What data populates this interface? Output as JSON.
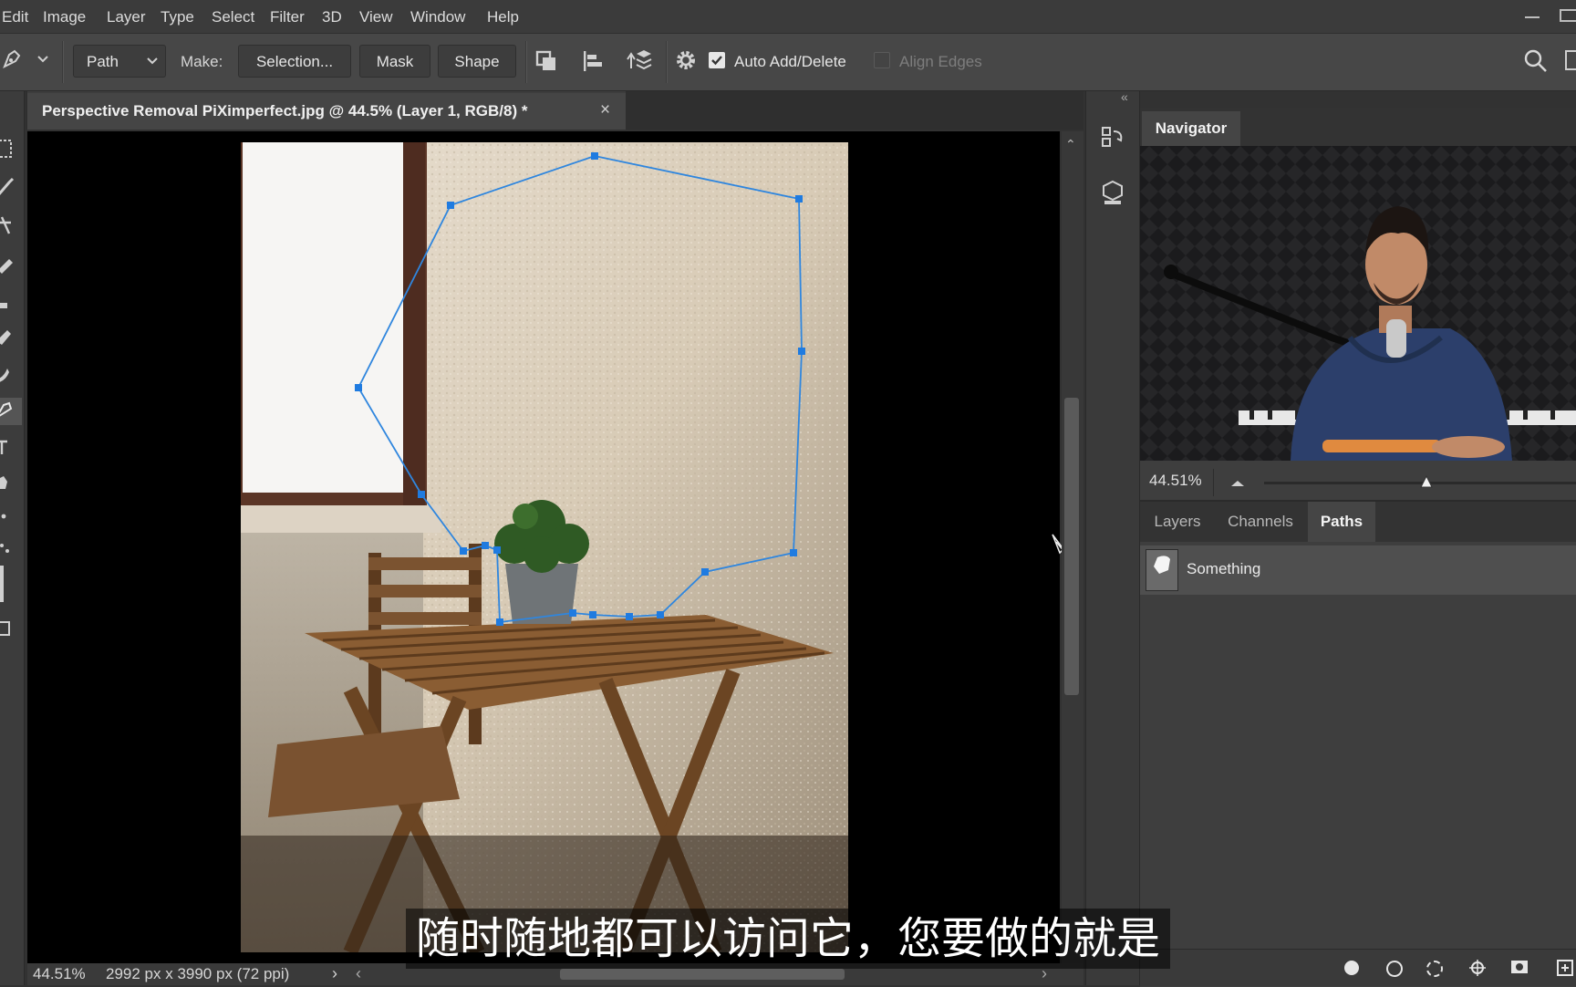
{
  "menu": {
    "items": [
      "Edit",
      "Image",
      "Layer",
      "Type",
      "Select",
      "Filter",
      "3D",
      "View",
      "Window",
      "Help"
    ]
  },
  "options": {
    "mode_value": "Path",
    "make_label": "Make:",
    "selection_btn": "Selection...",
    "mask_btn": "Mask",
    "shape_btn": "Shape",
    "auto_add_delete_label": "Auto Add/Delete",
    "auto_add_delete_checked": true,
    "align_edges_label": "Align Edges",
    "align_edges_checked": false
  },
  "document": {
    "tab_title": "Perspective Removal PiXimperfect.jpg @ 44.5% (Layer 1, RGB/8) *",
    "close_glyph": "×"
  },
  "status": {
    "zoom": "44.51%",
    "doc_info": "2992 px x 3990 px (72 ppi)",
    "arrow": "›",
    "scroll_left": "‹",
    "scroll_right": "›"
  },
  "navigator": {
    "tab_label": "Navigator",
    "zoom_value": "44.51%",
    "zoom_slider_fraction": 0.52
  },
  "paths_panel": {
    "tabs": [
      "Layers",
      "Channels",
      "Paths"
    ],
    "active_tab": "Paths",
    "paths": [
      {
        "name": "Something"
      }
    ]
  },
  "subtitle": {
    "text": "随时随地都可以访问它，您要做的就是"
  },
  "colors": {
    "path_stroke": "#2f86de",
    "anchor_fill": "#1f7be0",
    "canvas_bg": "#000000",
    "panel_bg": "#3e3e3e"
  },
  "icons": {
    "pen_tool": "pen-icon",
    "search": "search-icon",
    "gear": "gear-icon",
    "collapse": "«"
  }
}
